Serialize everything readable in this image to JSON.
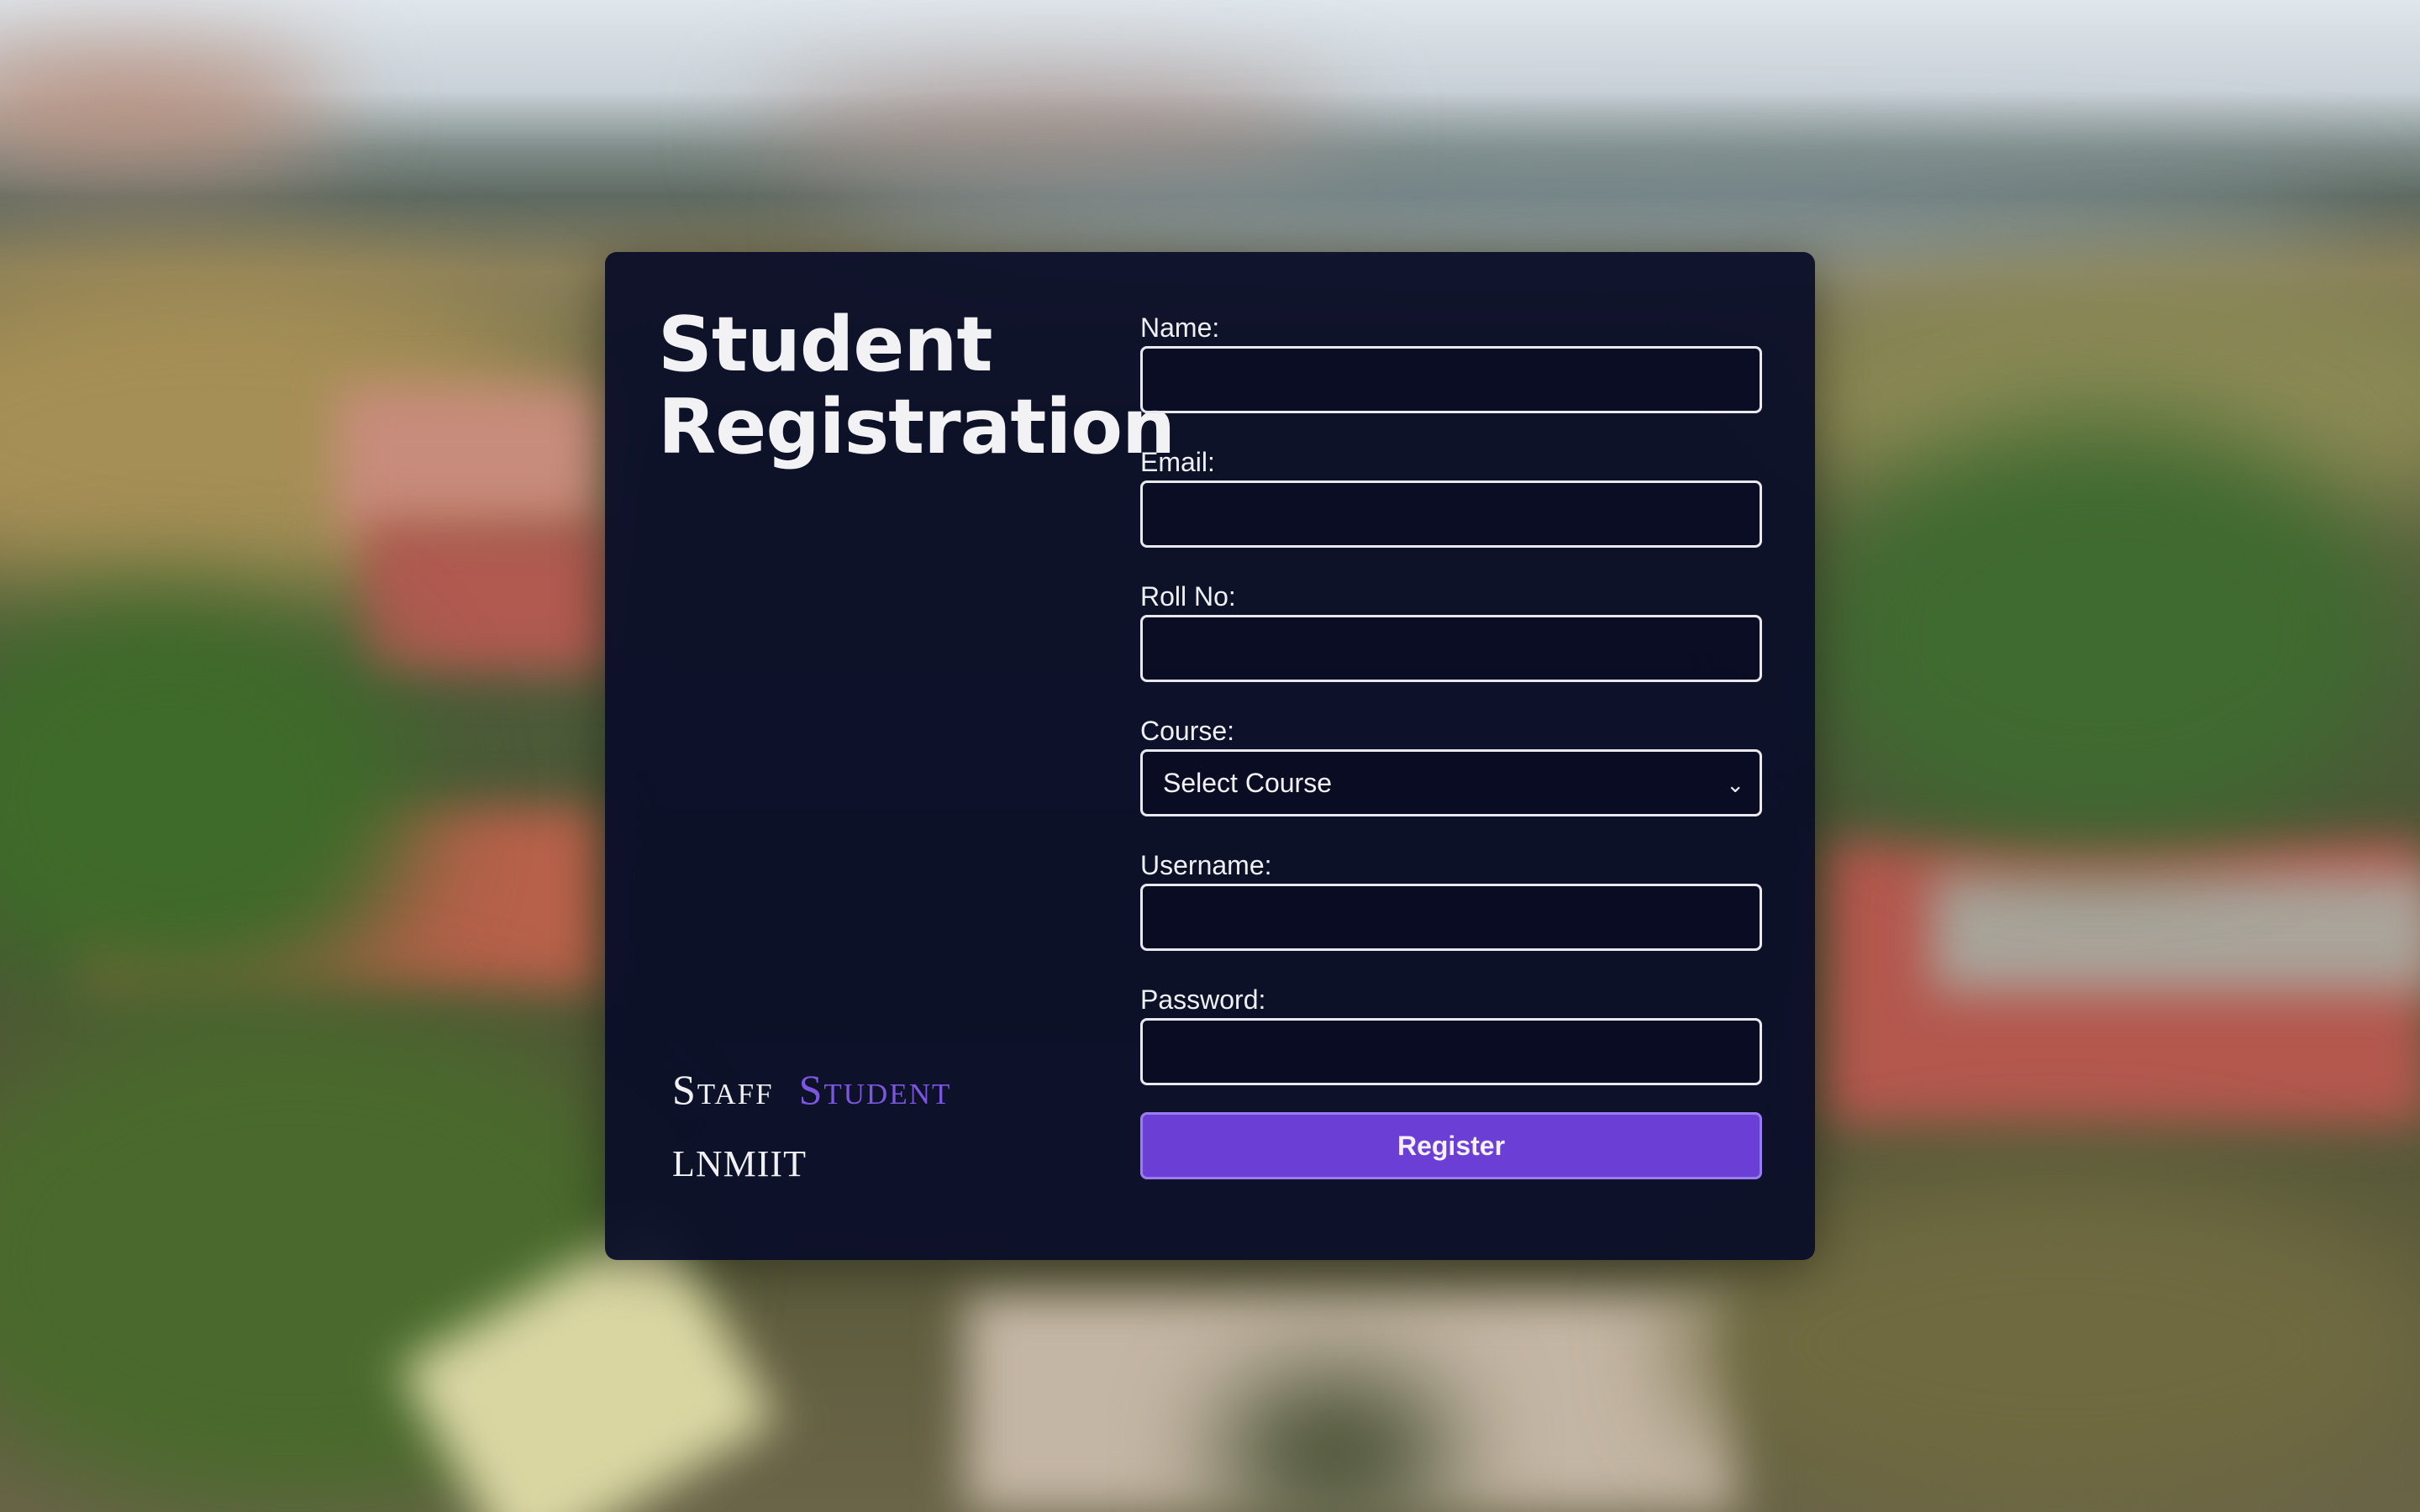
{
  "page": {
    "title_line1": "Student",
    "title_line2": "Registration"
  },
  "brand": {
    "staff": "Staff",
    "student": "Student",
    "org": "LNMIIT"
  },
  "form": {
    "name_label": "Name:",
    "email_label": "Email:",
    "roll_label": "Roll No:",
    "course_label": "Course:",
    "course_selected": "Select Course",
    "username_label": "Username:",
    "password_label": "Password:",
    "register_label": "Register"
  },
  "colors": {
    "card_bg": "#0a0e28",
    "accent": "#6b3fd6",
    "brand_accent": "#7b57e0",
    "text": "#f2f2f4"
  },
  "icons": {
    "course_dropdown": "chevron-down-icon"
  }
}
